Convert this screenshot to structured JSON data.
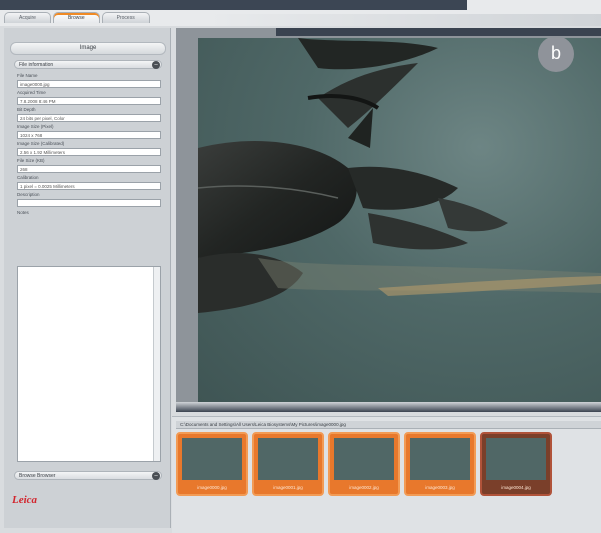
{
  "tabs": [
    {
      "label": "Acquire",
      "active": false
    },
    {
      "label": "Browse",
      "active": true
    },
    {
      "label": "Process",
      "active": false
    }
  ],
  "left_panel": {
    "title": "Image",
    "section_title": "File information",
    "fields": [
      {
        "label": "File Name",
        "value": "image0000.jpg"
      },
      {
        "label": "Acquired Time",
        "value": "7.8.2008 8:46 PM"
      },
      {
        "label": "Bit Depth",
        "value": "24 bits per pixel, Color"
      },
      {
        "label": "Image Size (Pixel)",
        "value": "1024 x 768"
      },
      {
        "label": "Image Size (Calibrated)",
        "value": "2.56 x 1.92 Millimeters"
      },
      {
        "label": "File Size (KB)",
        "value": "268"
      },
      {
        "label": "Calibration",
        "value": "1 pixel = 0.0025 Millimeters"
      },
      {
        "label": "Description",
        "value": ""
      }
    ],
    "notes_label": "Notes",
    "navigator_label": "Browse Browser",
    "logo_text": "Leica"
  },
  "viewer": {
    "badge": "b"
  },
  "filmstrip": {
    "path": "C:\\Documents and Settings\\All Users\\Leica Biosystems\\My Pictures\\image0000.jpg",
    "thumbnails": [
      {
        "label": "image0000.jpg",
        "selected": false
      },
      {
        "label": "image0001.jpg",
        "selected": false
      },
      {
        "label": "image0002.jpg",
        "selected": false
      },
      {
        "label": "image0003.jpg",
        "selected": false
      },
      {
        "label": "image0004.jpg",
        "selected": true
      }
    ]
  },
  "colors": {
    "accent": "#f08a24",
    "thumb": "#e8782c",
    "thumb_selected": "#7a3f2a",
    "logo": "#d2262e"
  },
  "icons": {
    "collapse": "circle-collapse-icon",
    "logo": "leica-logo"
  }
}
